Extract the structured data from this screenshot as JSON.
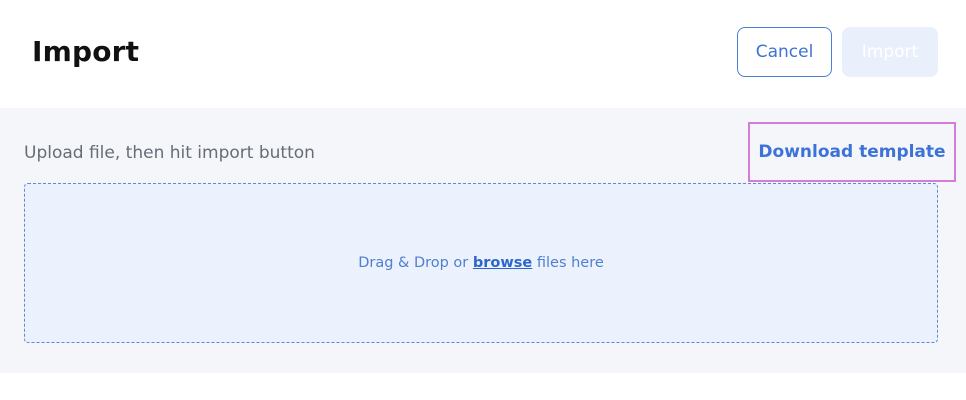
{
  "header": {
    "title": "Import",
    "cancel_label": "Cancel",
    "import_label": "Import"
  },
  "content": {
    "hint": "Upload file, then hit import button",
    "download_template_label": "Download template"
  },
  "dropzone": {
    "text_before": "Drag & Drop or",
    "browse_label": "browse",
    "text_after": "files here"
  },
  "colors": {
    "accent": "#3d72d8",
    "panel_background": "#f5f6fa",
    "dropzone_background": "#ebf1fd",
    "highlight_border": "#d77bd9",
    "import_disabled_background": "#e9f0fc"
  }
}
